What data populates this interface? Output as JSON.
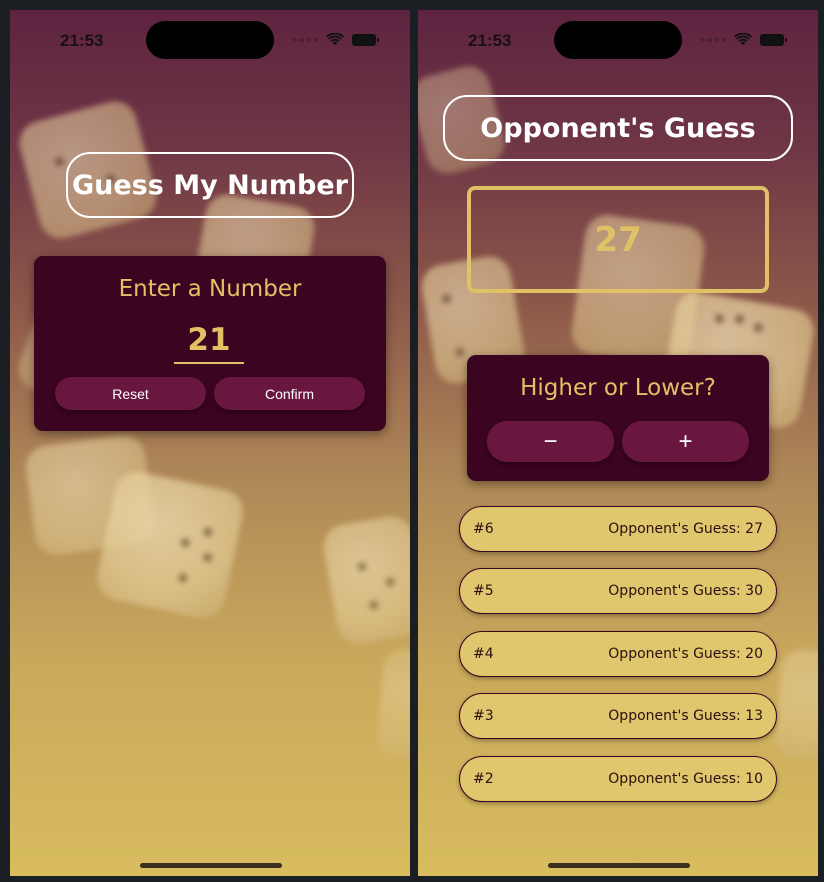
{
  "status_bar": {
    "time": "21:53"
  },
  "start_screen": {
    "title": "Guess My Number",
    "card_title": "Enter a Number",
    "input_value": "21",
    "reset_label": "Reset",
    "confirm_label": "Confirm"
  },
  "game_screen": {
    "title": "Opponent's Guess",
    "current_guess": "27",
    "card_title": "Higher or Lower?",
    "minus_label": "−",
    "plus_label": "+",
    "log": [
      {
        "round": "#6",
        "text": "Opponent's Guess: 27"
      },
      {
        "round": "#5",
        "text": "Opponent's Guess: 30"
      },
      {
        "round": "#4",
        "text": "Opponent's Guess: 20"
      },
      {
        "round": "#3",
        "text": "Opponent's Guess: 13"
      },
      {
        "round": "#2",
        "text": "Opponent's Guess: 10"
      }
    ]
  },
  "colors": {
    "card_bg": "#3b0420",
    "button_bg": "#6a1740",
    "accent": "#e0c165",
    "log_item_bg": "#e0c66d"
  },
  "icons": [
    "wifi-icon",
    "battery-icon",
    "cellular-dots-icon",
    "minus-icon",
    "plus-icon"
  ]
}
